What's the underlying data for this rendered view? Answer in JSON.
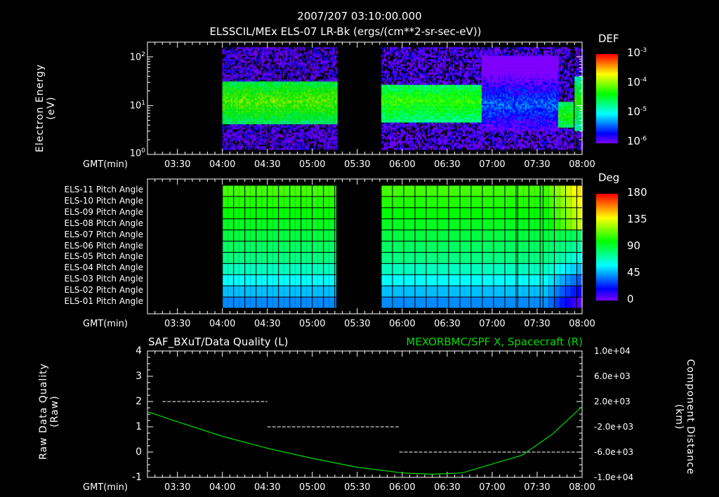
{
  "header": {
    "datetime": "2007/207 03:10:00.000",
    "title": "ELSSCIL/MEx ELS-07 LR-Bk  (ergs/(cm**2-sr-sec-eV))"
  },
  "time_axis": {
    "label": "GMT(min)",
    "start": "03:10",
    "end": "08:00",
    "ticks": [
      "03:30",
      "04:00",
      "04:30",
      "05:00",
      "05:30",
      "06:00",
      "06:30",
      "07:00",
      "07:30",
      "08:00"
    ]
  },
  "chart_data": [
    {
      "type": "heatmap",
      "title": "ELSSCIL/MEx ELS-07 LR-Bk  (ergs/(cm**2-sr-sec-eV))",
      "ylabel": "Electron Energy",
      "ylabel_units": "(eV)",
      "yscale": "log",
      "ylim": [
        1,
        200
      ],
      "yticks": [
        {
          "base": "10",
          "exp": "0",
          "value": 1
        },
        {
          "base": "10",
          "exp": "1",
          "value": 10
        },
        {
          "base": "10",
          "exp": "2",
          "value": 100
        }
      ],
      "colorbar": {
        "label": "DEF",
        "scale": "log",
        "range": [
          1e-06,
          0.001
        ],
        "ticks": [
          {
            "base": "10",
            "exp": "-3"
          },
          {
            "base": "10",
            "exp": "-4"
          },
          {
            "base": "10",
            "exp": "-5"
          },
          {
            "base": "10",
            "exp": "-6"
          }
        ]
      },
      "segments": [
        {
          "start": "04:00",
          "end": "05:16",
          "band_eV": [
            4,
            30
          ],
          "peak_eV": 12,
          "peak_def": 8e-05
        },
        {
          "start": "05:46",
          "end": "06:53",
          "band_eV": [
            4.5,
            25
          ],
          "peak_eV": 12,
          "peak_def": 6e-05
        },
        {
          "start": "06:53",
          "end": "07:44",
          "band_eV": [
            3,
            100
          ],
          "peak_eV": 10,
          "peak_def": 4e-06
        },
        {
          "start": "07:44",
          "end": "07:54",
          "band_eV": [
            3.5,
            12
          ],
          "peak_eV": 6,
          "peak_def": 5e-05
        },
        {
          "start": "07:55",
          "end": "08:00",
          "band_eV": [
            3,
            40
          ],
          "peak_eV": 12,
          "peak_def": 6e-05
        }
      ]
    },
    {
      "type": "heatmap",
      "colorbar": {
        "label": "Deg",
        "range": [
          0,
          180
        ],
        "ticks": [
          "180",
          "135",
          "90",
          "45",
          "0"
        ]
      },
      "rows": [
        "ELS-11 Pitch Angle",
        "ELS-10 Pitch Angle",
        "ELS-09 Pitch Angle",
        "ELS-08 Pitch Angle",
        "ELS-07 Pitch Angle",
        "ELS-06 Pitch Angle",
        "ELS-05 Pitch Angle",
        "ELS-04 Pitch Angle",
        "ELS-03 Pitch Angle",
        "ELS-02 Pitch Angle",
        "ELS-01 Pitch Angle"
      ],
      "row_values_deg": [
        110,
        105,
        100,
        95,
        90,
        85,
        80,
        70,
        60,
        50,
        42
      ],
      "segments": [
        {
          "start": "04:00",
          "end": "05:16"
        },
        {
          "start": "05:46",
          "end": "07:17"
        },
        {
          "start": "07:17",
          "end": "07:34",
          "note": "striped"
        },
        {
          "start": "07:34",
          "end": "08:00"
        }
      ]
    },
    {
      "type": "line",
      "left_title": "SAF_BXuT/Data Quality (L)",
      "right_title": "MEXORBMC/SPF X, Spacecraft (R)",
      "ylabel_left": "Raw Data Quality",
      "ylabel_left_units": "(Raw)",
      "ylabel_right": "Component Distance",
      "ylabel_right_units": "(km)",
      "ylim_left": [
        -1,
        4
      ],
      "yticks_left": [
        "4",
        "3",
        "2",
        "1",
        "0",
        "-1"
      ],
      "ylim_right": [
        -10000,
        10000
      ],
      "yticks_right": [
        "1.0e+04",
        "6.0e+03",
        "2.0e+03",
        "-2.0e+03",
        "-6.0e+03",
        "-1.0e+04"
      ],
      "series": [
        {
          "name": "Data Quality",
          "axis": "left",
          "color": "#ffffff",
          "style": "dashed",
          "steps": [
            {
              "start": "03:20",
              "end": "04:30",
              "value": 2
            },
            {
              "start": "04:30",
              "end": "05:58",
              "value": 1
            },
            {
              "start": "05:58",
              "end": "07:56",
              "value": 0
            }
          ]
        },
        {
          "name": "SPF X",
          "axis": "right",
          "color": "#00dd00",
          "x": [
            "03:10",
            "03:30",
            "04:00",
            "04:30",
            "05:00",
            "05:30",
            "06:00",
            "06:20",
            "06:40",
            "07:00",
            "07:20",
            "07:40",
            "08:00"
          ],
          "y": [
            400,
            -1200,
            -3500,
            -5400,
            -7000,
            -8400,
            -9300,
            -9500,
            -9300,
            -7900,
            -6500,
            -3200,
            1200
          ]
        }
      ]
    }
  ],
  "colors": {
    "background": "#000000",
    "axes": "#ffffff",
    "green": "#00dd00"
  }
}
